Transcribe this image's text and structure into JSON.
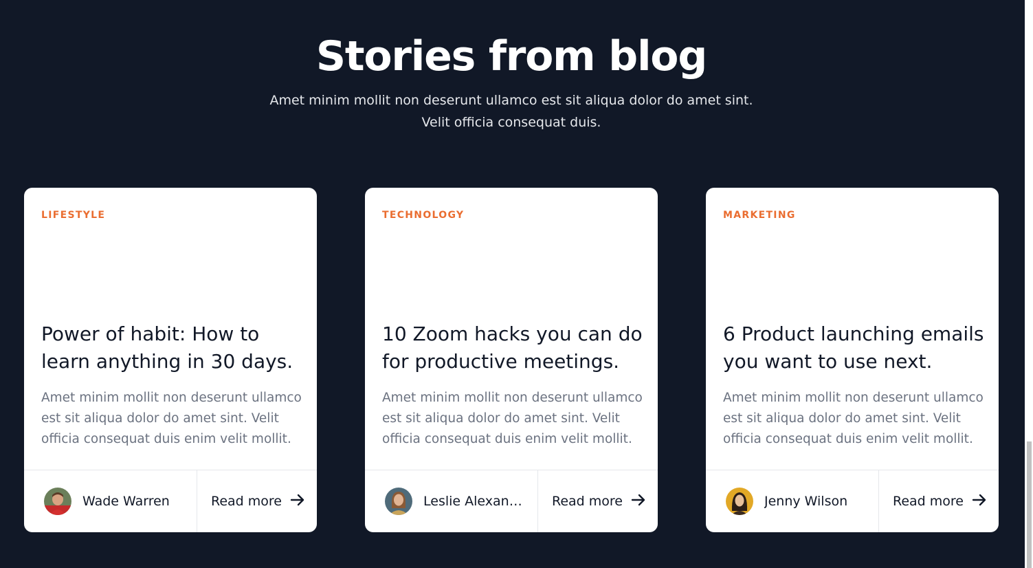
{
  "section": {
    "title": "Stories from blog",
    "subtitle": "Amet minim mollit non deserunt ullamco est sit aliqua dolor do amet sint. Velit officia consequat duis."
  },
  "posts": [
    {
      "category": "LIFESTYLE",
      "title": "Power of habit: How to learn anything in 30 days.",
      "excerpt": "Amet minim mollit non deserunt ullamco est sit aliqua dolor do amet sint. Velit officia consequat duis enim velit mollit.",
      "author": "Wade Warren",
      "read_more": "Read more"
    },
    {
      "category": "TECHNOLOGY",
      "title": "10 Zoom hacks you can do for productive meetings.",
      "excerpt": "Amet minim mollit non deserunt ullamco est sit aliqua dolor do amet sint. Velit officia consequat duis enim velit mollit.",
      "author": "Leslie Alexander",
      "read_more": "Read more"
    },
    {
      "category": "MARKETING",
      "title": "6 Product launching emails you want to use next.",
      "excerpt": "Amet minim mollit non deserunt ullamco est sit aliqua dolor do amet sint. Velit officia consequat duis enim velit mollit.",
      "author": "Jenny Wilson",
      "read_more": "Read more"
    }
  ],
  "colors": {
    "background": "#111827",
    "card": "#ffffff",
    "accent": "#ea6d30",
    "heading": "#111827",
    "body_text": "#6b7280"
  },
  "icons": {
    "read_more": "arrow-right-icon"
  }
}
